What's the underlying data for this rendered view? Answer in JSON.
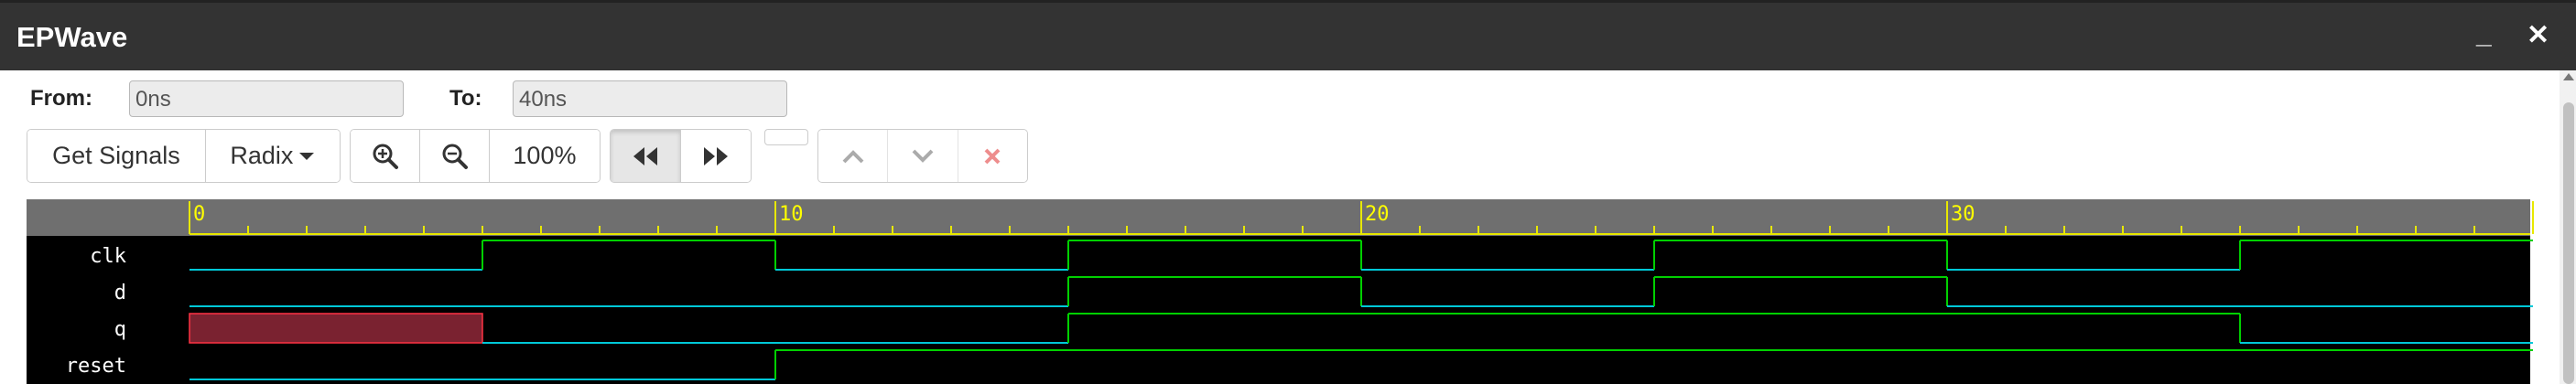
{
  "window": {
    "title": "EPWave",
    "minimize_label": "_",
    "close_label": "✕"
  },
  "range": {
    "from_label": "From:",
    "from_value": "0ns",
    "to_label": "To:",
    "to_value": "40ns"
  },
  "toolbar": {
    "get_signals_label": "Get Signals",
    "radix_label": "Radix",
    "zoom_in_icon": "zoom-in-icon",
    "zoom_out_icon": "zoom-out-icon",
    "zoom_level": "100%",
    "rewind_icon": "backward-icon",
    "forward_icon": "forward-icon",
    "up_icon": "chevron-up-icon",
    "down_icon": "chevron-down-icon",
    "remove_icon": "remove-icon"
  },
  "timeline": {
    "t_start": 0,
    "t_end": 40,
    "ticks": [
      "0",
      "10",
      "20",
      "30"
    ],
    "colors": {
      "ruler": "#6f6f6f",
      "ruler_line": "#e8e800",
      "tick_label": "#ffff00",
      "bg": "#000000",
      "low": "#00c8d8",
      "high": "#00d000",
      "undefined": "#7a2230",
      "undefined_edge": "#ff3344",
      "label": "#ffffff"
    }
  },
  "signals": [
    {
      "name": "clk",
      "segments": [
        [
          0,
          5,
          0
        ],
        [
          5,
          10,
          1
        ],
        [
          10,
          15,
          0
        ],
        [
          15,
          20,
          1
        ],
        [
          20,
          25,
          0
        ],
        [
          25,
          30,
          1
        ],
        [
          30,
          35,
          0
        ],
        [
          35,
          40,
          1
        ]
      ]
    },
    {
      "name": "d",
      "segments": [
        [
          0,
          15,
          0
        ],
        [
          15,
          20,
          1
        ],
        [
          20,
          25,
          0
        ],
        [
          25,
          30,
          1
        ],
        [
          30,
          40,
          0
        ]
      ]
    },
    {
      "name": "q",
      "segments": [
        [
          0,
          5,
          "x"
        ],
        [
          5,
          15,
          0
        ],
        [
          15,
          35,
          1
        ],
        [
          35,
          40,
          0
        ]
      ]
    },
    {
      "name": "reset",
      "segments": [
        [
          0,
          10,
          0
        ],
        [
          10,
          40,
          1
        ]
      ]
    }
  ]
}
